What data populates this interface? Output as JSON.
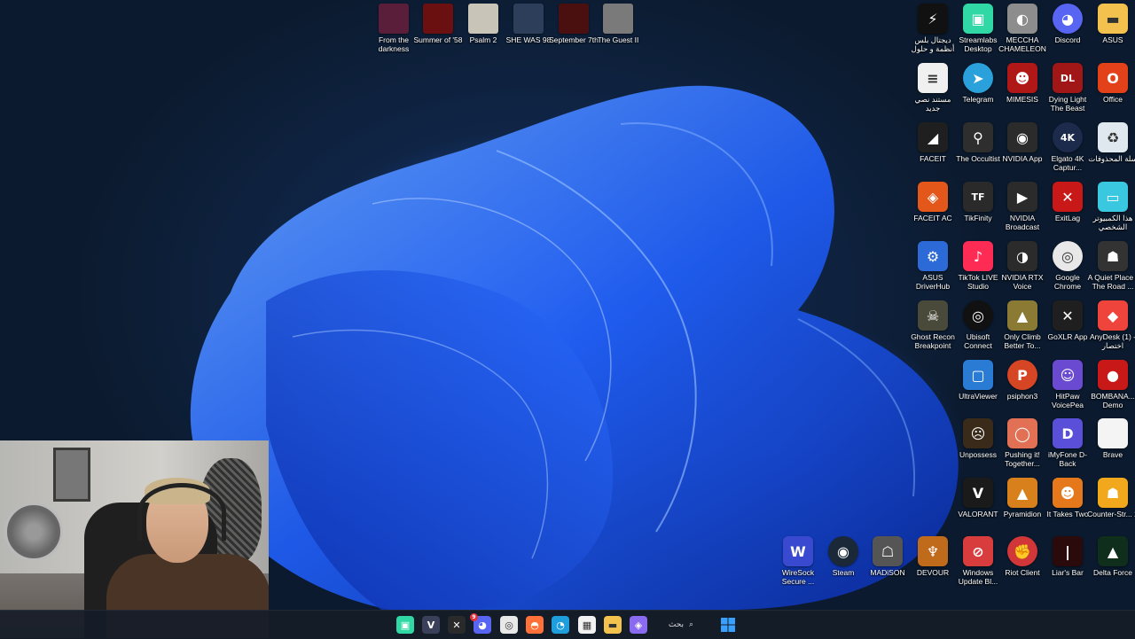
{
  "top_icons": [
    {
      "label": "From the darkness",
      "icon": "game-icon",
      "color": "#5a1e3a"
    },
    {
      "label": "Summer of '58",
      "icon": "game-icon",
      "color": "#6a1010"
    },
    {
      "label": "Psalm 2",
      "icon": "mask-icon",
      "color": "#c9c4b8"
    },
    {
      "label": "SHE WAS 98",
      "icon": "game-icon",
      "color": "#2c3e5a"
    },
    {
      "label": "September 7th",
      "icon": "game-icon",
      "color": "#4a1010"
    },
    {
      "label": "The Guest II",
      "icon": "game-icon",
      "color": "#7a7a7a"
    }
  ],
  "desktop_icons": [
    {
      "label": "ديجتال بلس أنظمة و حلول",
      "icon": "lightning-icon",
      "color": "#111111",
      "glyph": "⚡"
    },
    {
      "label": "Streamlabs Desktop",
      "icon": "streamlabs-icon",
      "color": "#2fd8a4",
      "glyph": "▣"
    },
    {
      "label": "MECCHA CHAMELEON",
      "icon": "game-icon",
      "color": "#8d8d8d",
      "glyph": "◐"
    },
    {
      "label": "Discord",
      "icon": "discord-icon",
      "color": "#5865f2",
      "glyph": "◕"
    },
    {
      "label": "ASUS",
      "icon": "folder-icon",
      "color": "#f2c14e",
      "glyph": "▬"
    },
    {
      "label": "مستند نصي جديد",
      "icon": "text-document-icon",
      "color": "#f0f0f0",
      "glyph": "≡"
    },
    {
      "label": "Telegram",
      "icon": "telegram-icon",
      "color": "#2aa1da",
      "glyph": "➤"
    },
    {
      "label": "MIMESIS",
      "icon": "game-icon",
      "color": "#b01818",
      "glyph": "☻"
    },
    {
      "label": "Dying Light The Beast",
      "icon": "game-icon",
      "color": "#a11616",
      "glyph": "DL"
    },
    {
      "label": "Office",
      "icon": "office-icon",
      "color": "#e3411a",
      "glyph": "O"
    },
    {
      "label": "FACEIT",
      "icon": "faceit-icon",
      "color": "#1f1f1f",
      "glyph": "◢"
    },
    {
      "label": "The Occultist",
      "icon": "game-icon",
      "color": "#2e2e2e",
      "glyph": "⚲"
    },
    {
      "label": "NVIDIA App",
      "icon": "nvidia-icon",
      "color": "#2b2b2b",
      "glyph": "◉"
    },
    {
      "label": "Elgato 4K Captur...",
      "icon": "elgato-icon",
      "color": "#1c2b4c",
      "glyph": "4K"
    },
    {
      "label": "سلة المحذوفات",
      "icon": "recycle-bin-icon",
      "color": "#dfe8ee",
      "glyph": "♻"
    },
    {
      "label": "FACEIT AC",
      "icon": "faceit-ac-icon",
      "color": "#e4571b",
      "glyph": "◈"
    },
    {
      "label": "TikFinity",
      "icon": "tikfinity-icon",
      "color": "#2a2a2a",
      "glyph": "TF"
    },
    {
      "label": "NVIDIA Broadcast",
      "icon": "nvidia-broadcast-icon",
      "color": "#2b2b2b",
      "glyph": "▶"
    },
    {
      "label": "ExitLag",
      "icon": "exitlag-icon",
      "color": "#c81818",
      "glyph": "✕"
    },
    {
      "label": "هذا الكمبيوتر الشخصي",
      "icon": "monitor-icon",
      "color": "#3ac7e0",
      "glyph": "▭"
    },
    {
      "label": "ASUS DriverHub",
      "icon": "gear-icon",
      "color": "#2c6ad8",
      "glyph": "⚙"
    },
    {
      "label": "TikTok LIVE Studio",
      "icon": "tiktok-icon",
      "color": "#fe2c55",
      "glyph": "♪"
    },
    {
      "label": "NVIDIA RTX Voice",
      "icon": "nvidia-voice-icon",
      "color": "#2b2b2b",
      "glyph": "◑"
    },
    {
      "label": "Google Chrome",
      "icon": "chrome-icon",
      "color": "#e8e8e8",
      "glyph": "◎"
    },
    {
      "label": "A Quiet Place - The Road ...",
      "icon": "game-icon",
      "color": "#333333",
      "glyph": "☗"
    },
    {
      "label": "Ghost Recon Breakpoint",
      "icon": "game-icon",
      "color": "#4a4a3a",
      "glyph": "☠"
    },
    {
      "label": "Ubisoft Connect",
      "icon": "ubisoft-icon",
      "color": "#111111",
      "glyph": "◎"
    },
    {
      "label": "Only Climb Better To...",
      "icon": "game-icon",
      "color": "#8a7a34",
      "glyph": "▲"
    },
    {
      "label": "GoXLR App",
      "icon": "goxlr-icon",
      "color": "#1f1f1f",
      "glyph": "✕"
    },
    {
      "label": "AnyDesk (1) - اختصار",
      "icon": "anydesk-icon",
      "color": "#ef443b",
      "glyph": "◆"
    },
    {
      "label": "UltraViewer",
      "icon": "ultraviewer-icon",
      "color": "#2a7bd4",
      "glyph": "▢"
    },
    {
      "label": "psiphon3",
      "icon": "psiphon-icon",
      "color": "#d64524",
      "glyph": "P"
    },
    {
      "label": "HitPaw VoicePea",
      "icon": "hitpaw-icon",
      "color": "#6a4ad0",
      "glyph": "☺"
    },
    {
      "label": "BOMBANA... Demo",
      "icon": "game-icon",
      "color": "#c81818",
      "glyph": "●"
    },
    {
      "label": "Unpossess",
      "icon": "game-icon",
      "color": "#3a2a1a",
      "glyph": "☹"
    },
    {
      "label": "Pushing it! Together...",
      "icon": "game-icon",
      "color": "#e27054",
      "glyph": "◯"
    },
    {
      "label": "iMyFone D-Back",
      "icon": "imyfone-icon",
      "color": "#5a4fd8",
      "glyph": "D"
    },
    {
      "label": "Brave",
      "icon": "blank-document-icon",
      "color": "#f4f4f4",
      "glyph": ""
    },
    {
      "label": "VALORANT",
      "icon": "valorant-icon",
      "color": "#1a1a1a",
      "glyph": "V"
    },
    {
      "label": "Pyramidion",
      "icon": "game-icon",
      "color": "#d8801c",
      "glyph": "▲"
    },
    {
      "label": "It Takes Two",
      "icon": "game-icon",
      "color": "#e6781c",
      "glyph": "☻"
    },
    {
      "label": "Counter-Str... 2",
      "icon": "cs2-icon",
      "color": "#f2a81c",
      "glyph": "☗"
    },
    {
      "label": "WireSock Secure ...",
      "icon": "wiresock-icon",
      "color": "#3a4ad0",
      "glyph": "W"
    },
    {
      "label": "Steam",
      "icon": "steam-icon",
      "color": "#1b2838",
      "glyph": "◉"
    },
    {
      "label": "MADiSON",
      "icon": "game-icon",
      "color": "#555555",
      "glyph": "☖"
    },
    {
      "label": "DEVOUR",
      "icon": "game-icon",
      "color": "#c06a1c",
      "glyph": "♆"
    },
    {
      "label": "Windows Update Bl...",
      "icon": "windows-update-blocker-icon",
      "color": "#d83c3c",
      "glyph": "⊘"
    },
    {
      "label": "Riot Client",
      "icon": "riot-icon",
      "color": "#d13639",
      "glyph": "✊"
    },
    {
      "label": "Liar's Bar",
      "icon": "game-icon",
      "color": "#2a0a0a",
      "glyph": "|"
    },
    {
      "label": "Delta Force",
      "icon": "game-icon",
      "color": "#0f2f1c",
      "glyph": "▲"
    }
  ],
  "taskbar": {
    "search_label": "بحث",
    "apps": [
      {
        "name": "streamlabs-taskbar-icon",
        "color": "#2fd8a4",
        "glyph": "▣"
      },
      {
        "name": "valorant-taskbar-icon",
        "color": "#3a3f5a",
        "glyph": "V"
      },
      {
        "name": "goxlr-taskbar-icon",
        "color": "#2a2a2a",
        "glyph": "✕"
      },
      {
        "name": "discord-taskbar-icon",
        "color": "#5865f2",
        "glyph": "◕"
      },
      {
        "name": "chrome-taskbar-icon",
        "color": "#e8e8e8",
        "glyph": "◎"
      },
      {
        "name": "firefox-taskbar-icon",
        "color": "#ff7139",
        "glyph": "◓"
      },
      {
        "name": "edge-taskbar-icon",
        "color": "#1f9ede",
        "glyph": "◔"
      },
      {
        "name": "store-taskbar-icon",
        "color": "#f2f2f2",
        "glyph": "▦"
      },
      {
        "name": "file-explorer-taskbar-icon",
        "color": "#f2c14e",
        "glyph": "▬"
      },
      {
        "name": "copilot-taskbar-icon",
        "color": "#8a6af0",
        "glyph": "◈"
      }
    ],
    "discord_badge": "9"
  }
}
